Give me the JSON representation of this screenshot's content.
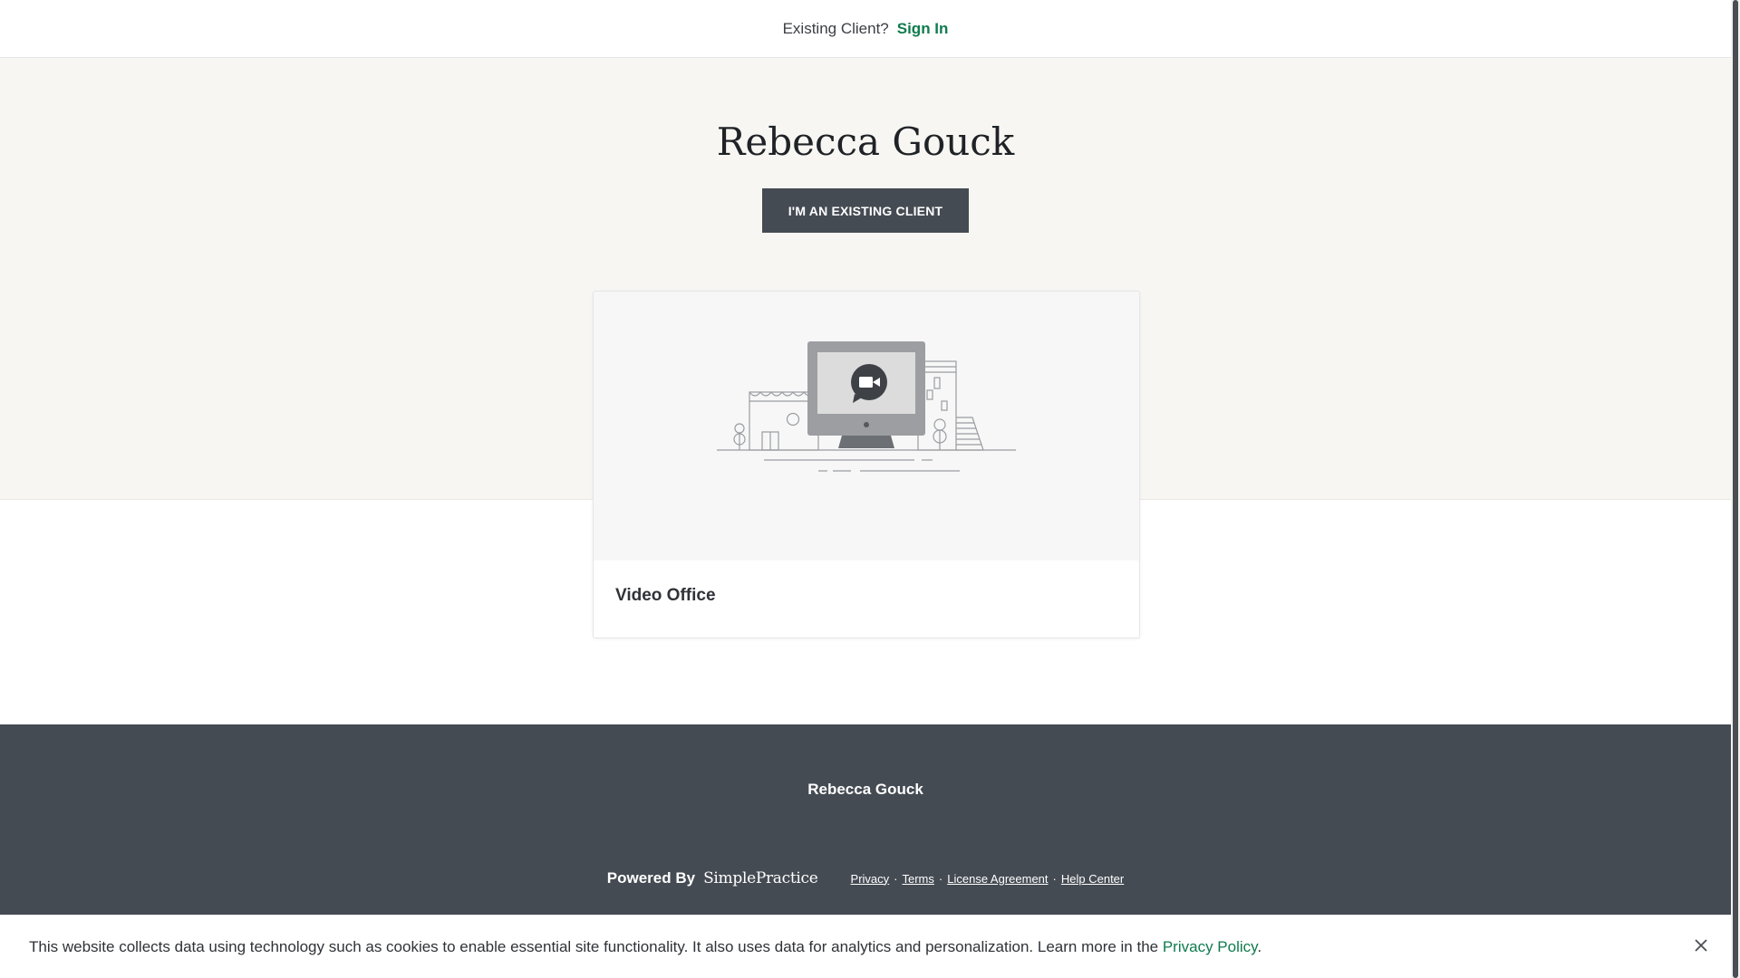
{
  "topbar": {
    "prompt": "Existing Client?",
    "sign_in": "Sign In"
  },
  "hero": {
    "title": "Rebecca Gouck",
    "existing_client_button": "I'M AN EXISTING CLIENT"
  },
  "card": {
    "label": "Video Office",
    "illustration": "video-office-illustration"
  },
  "footer": {
    "name": "Rebecca Gouck",
    "powered_by": "Powered By",
    "logo_text": "SimplePractice",
    "links": {
      "privacy": "Privacy",
      "terms": "Terms",
      "license": "License Agreement",
      "help": "Help Center"
    },
    "separator": "·"
  },
  "cookie_banner": {
    "text_before": "This website collects data using technology such as cookies to enable essential site functionality. It also uses data for analytics and personalization. Learn more in the ",
    "link": "Privacy Policy",
    "text_after": ".",
    "close_icon": "close-icon"
  },
  "colors": {
    "accent_green": "#0f7c4e",
    "dark_slate": "#454b53",
    "hero_bg": "#f7f6f2"
  }
}
